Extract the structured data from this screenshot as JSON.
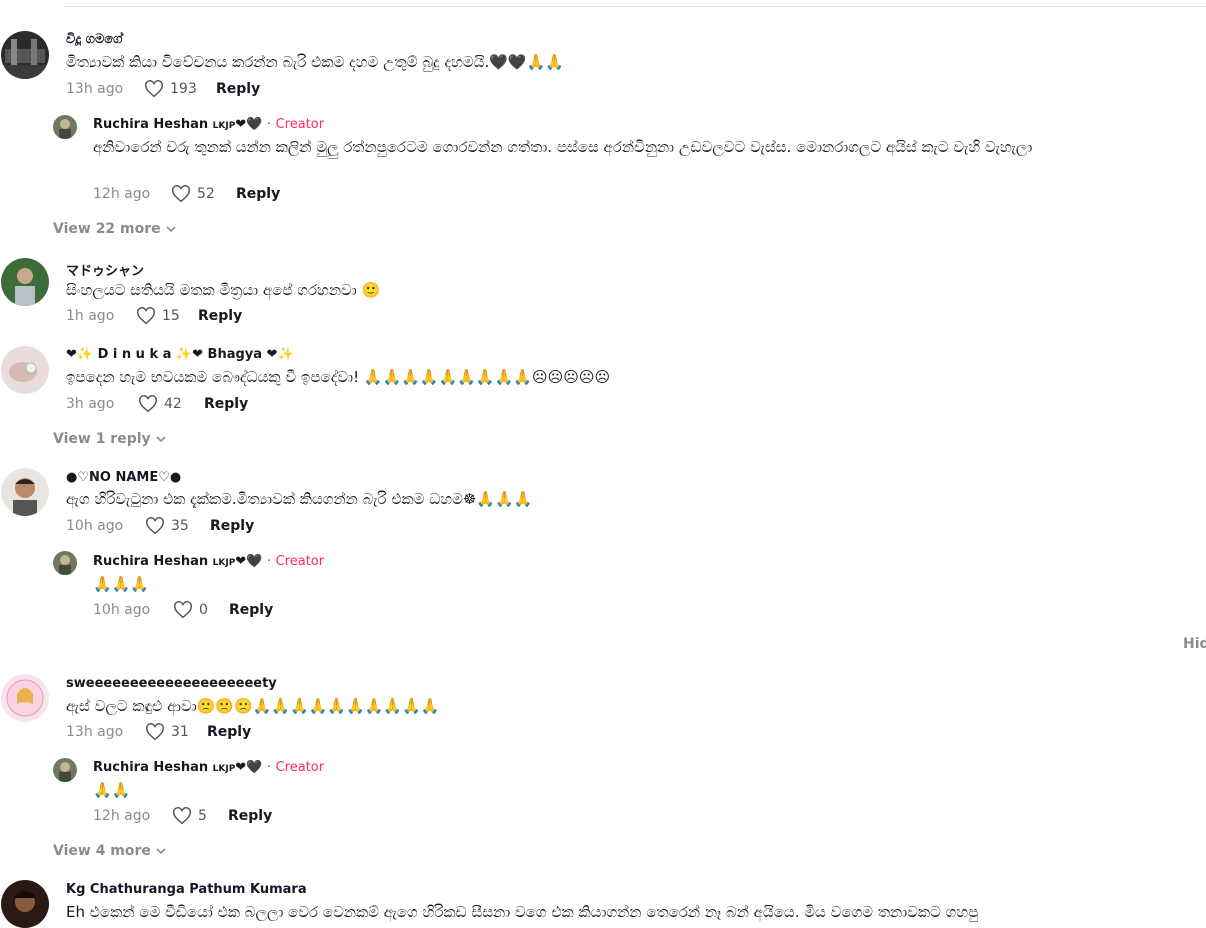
{
  "comments": [
    {
      "name": "විදූ ගමගේ",
      "text": "මිත්‍යාවක් කියා විවේචනය කරන්න බැරි එකම දහම උතුම් බුදු දහමයි.🖤🖤🙏🙏",
      "time": "13h ago",
      "likes": "193",
      "reply": "Reply",
      "replies": [
        {
          "name": "Ruchira Heshan",
          "tag": "LKJP",
          "hearts": "❤🖤",
          "dot": "·",
          "creator": "Creator",
          "text": "අනිවාරෙන් චරු තුනක් යන්න කලින් මුලු රත්නපුරෙටම ගොරවන්න ගත්තා. පස්සෙ අරන්විනුනා උඩවලවට වැස්ස. මොනරාගලට අයිස් කැට වැහි වැහැලා",
          "time": "12h ago",
          "likes": "52",
          "reply": "Reply"
        }
      ],
      "view_more": "View 22 more"
    },
    {
      "name": "マドゥシャン",
      "text": "සිංහලයට සතියයි මතක මිත්‍රයා අපේ ගරහනවා 🙂",
      "time": "1h ago",
      "likes": "15",
      "reply": "Reply"
    },
    {
      "name": "❤✨ D i n u k a ✨❤ Bhagya ❤✨",
      "text": "ඉපදෙන හැම භවයකම බෞද්ධයකු වී ඉපදේවා! 🙏🙏🙏🙏🙏🙏🙏🙏🙏☹☹☹☹☹",
      "time": "3h ago",
      "likes": "42",
      "reply": "Reply",
      "view_more": "View 1 reply"
    },
    {
      "name": "●♡NO NAME♡●",
      "text": "ඇග හිරිවැටුනා එක දැක්කම.මිත්‍යාවක් කියගන්න බැරි එකම ධහම☸🙏🙏🙏",
      "time": "10h ago",
      "likes": "35",
      "reply": "Reply",
      "replies": [
        {
          "name": "Ruchira Heshan",
          "tag": "LKJP",
          "hearts": "❤🖤",
          "dot": "·",
          "creator": "Creator",
          "text": "🙏🙏🙏",
          "time": "10h ago",
          "likes": "0",
          "reply": "Reply"
        }
      ],
      "hide": "Hid"
    },
    {
      "name": "sweeeeeeeeeeeeeeeeeeeety",
      "text": "ඇස් වලට කඳුළු ආවා🙁🙁🙁🙏🙏🙏🙏🙏🙏🙏🙏🙏🙏",
      "time": "13h ago",
      "likes": "31",
      "reply": "Reply",
      "replies": [
        {
          "name": "Ruchira Heshan",
          "tag": "LKJP",
          "hearts": "❤🖤",
          "dot": "·",
          "creator": "Creator",
          "text": "🙏🙏",
          "time": "12h ago",
          "likes": "5",
          "reply": "Reply"
        }
      ],
      "view_more": "View 4 more"
    },
    {
      "name": "Kg Chathuranga Pathum Kumara",
      "text": "Eh එකෙන් මෙ වීඩියෝ එක බලලා වෙර වෙනකම් ඇගෙ හිරිකඩ සීසනා වගෙ එක කියාගන්න තෙරෙන් නෑ බන් අයියෙ. මිය වගෙම තනාවකට ගහපු"
    }
  ]
}
